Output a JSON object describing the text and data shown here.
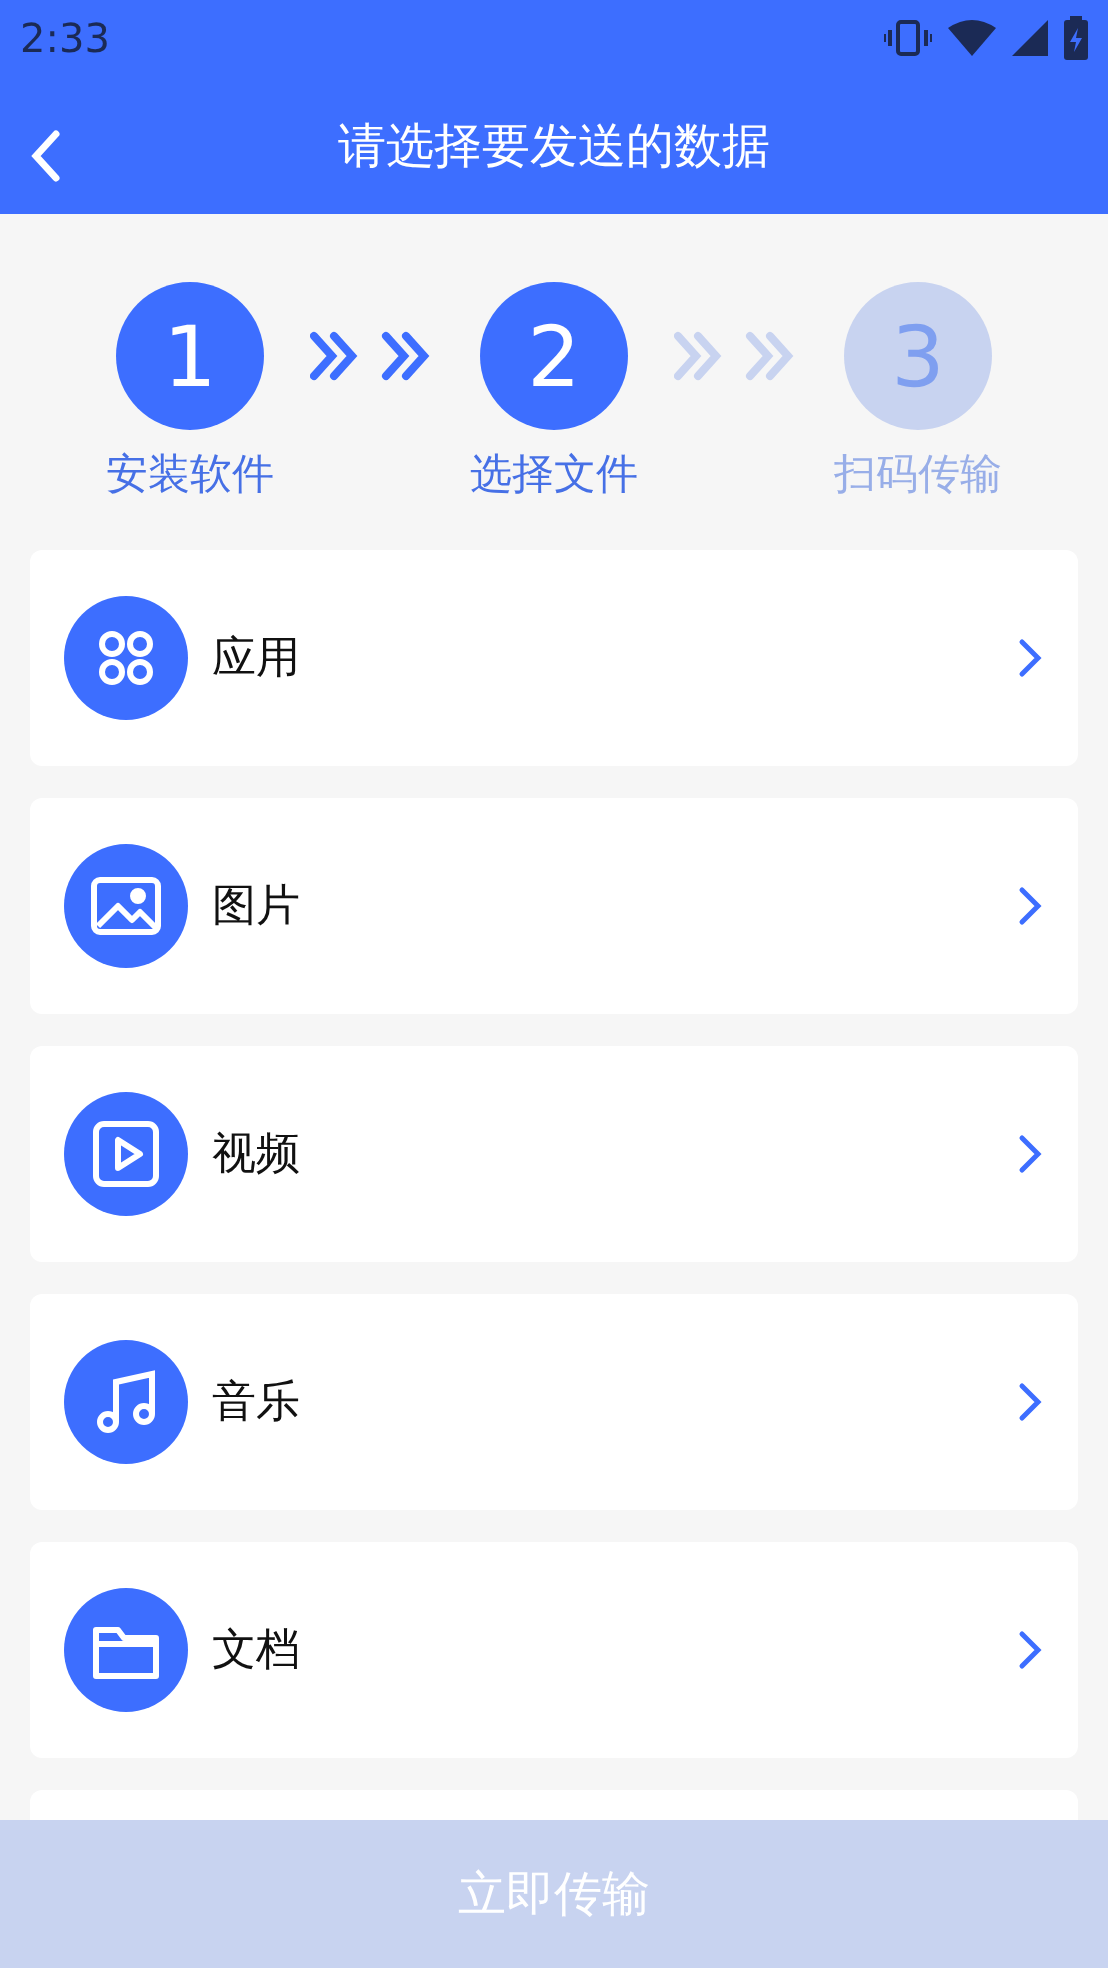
{
  "status_bar": {
    "time": "2:33"
  },
  "app_bar": {
    "title": "请选择要发送的数据"
  },
  "steps": [
    {
      "number": "1",
      "label": "安装软件",
      "active": true
    },
    {
      "number": "2",
      "label": "选择文件",
      "active": true
    },
    {
      "number": "3",
      "label": "扫码传输",
      "active": false
    }
  ],
  "items": [
    {
      "kind": "apps",
      "label": "应用"
    },
    {
      "kind": "image",
      "label": "图片"
    },
    {
      "kind": "video",
      "label": "视频"
    },
    {
      "kind": "music",
      "label": "音乐"
    },
    {
      "kind": "folder",
      "label": "文档"
    }
  ],
  "transfer_button": {
    "label": "立即传输",
    "disabled": true
  }
}
